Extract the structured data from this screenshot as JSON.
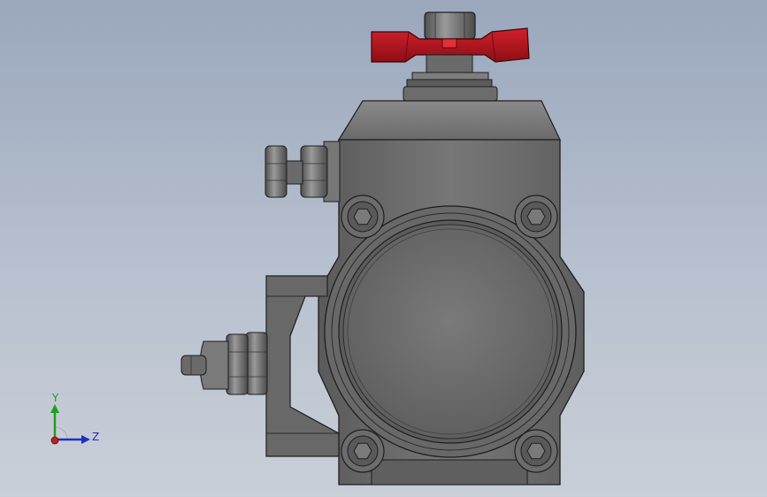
{
  "viewport": {
    "background_top": "#9aa7bc",
    "background_bottom": "#c9cfd8"
  },
  "model": {
    "body_color": "#6e6e6e",
    "body_dark": "#4a4a4a",
    "edge_color": "#1e1e1e",
    "handwheel_color": "#b3121b",
    "handwheel_dark": "#7a0c12",
    "bolt_icon": "hex-bolt-icon"
  },
  "triad": {
    "y_label": "Y",
    "z_label": "Z",
    "y_color": "#1fa01f",
    "z_color": "#1f2fc0",
    "origin_color": "#c01f1f"
  }
}
